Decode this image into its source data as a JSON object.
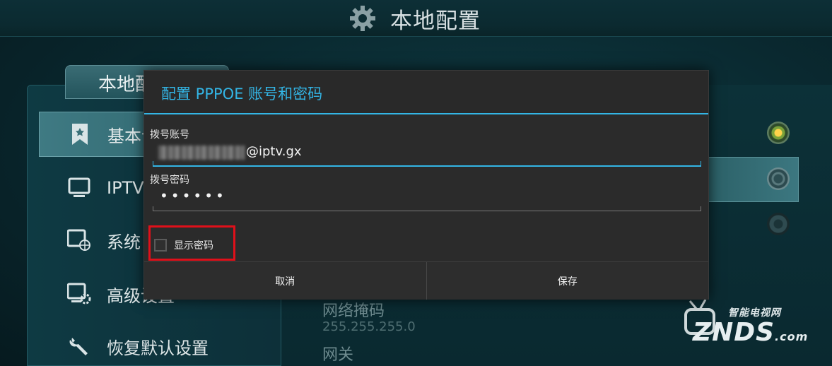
{
  "header": {
    "title": "本地配置",
    "icon": "gear-icon"
  },
  "sidebar": {
    "tab_label": "本地配",
    "items": [
      {
        "label": "基本设",
        "icon": "bookmark-icon"
      },
      {
        "label": "IPTV",
        "icon": "monitor-icon"
      },
      {
        "label": "系统",
        "icon": "network-monitor-icon"
      },
      {
        "label": "高级设置",
        "icon": "settings-monitor-icon"
      },
      {
        "label": "恢复默认设置",
        "icon": "wrench-icon"
      }
    ]
  },
  "background": {
    "netmask_label": "网络掩码",
    "netmask_value": "255.255.255.0",
    "gateway_label": "网关"
  },
  "dialog": {
    "title": "配置 PPPOE 账号和密码",
    "account_label": "拨号账号",
    "account_value": "@iptv.gx",
    "password_label": "拨号密码",
    "password_value": "••••••",
    "show_password_label": "显示密码",
    "show_password_checked": false,
    "cancel_label": "取消",
    "save_label": "保存"
  },
  "watermark": {
    "cn": "智能电视网",
    "en": "ZNDS",
    "suffix": ".com"
  },
  "colors": {
    "accent": "#33b5e5",
    "highlight_frame": "#e0101a",
    "dialog_bg": "#2b2b2b"
  }
}
